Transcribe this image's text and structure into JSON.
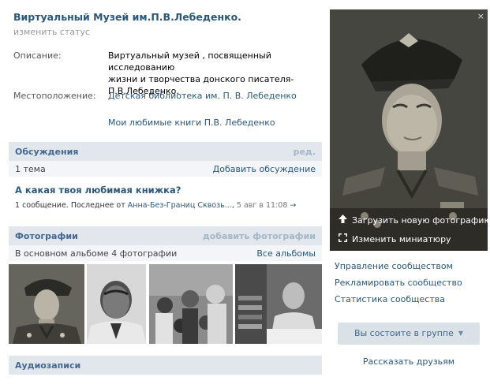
{
  "group": {
    "title": "Виртуальный Музей им.П.В.Лебеденко.",
    "status_link": "изменить статус"
  },
  "info": {
    "description_label": "Описание:",
    "description_lines": [
      "Виртуальный музей , посвященный исследованию",
      "жизни и творчества донского писателя-",
      "П.В.Лебеденко."
    ],
    "location_label": "Местоположение:",
    "location_value": "Детская библиотека им. П. В. Лебеденко",
    "favorite_link": "Мои любимые книги П.В. Лебеденко"
  },
  "discussions": {
    "header": "Обсуждения",
    "edit_label": "ред.",
    "count_text": "1 тема",
    "add_label": "Добавить обсуждение",
    "topic_title": "А какая твоя любимая книжка?",
    "topic_meta_prefix": "1 сообщение. Последнее от",
    "topic_author": "Анна-Без-Границ Сквозь...",
    "topic_time": "5 авг в 11:08",
    "topic_arrow": "→"
  },
  "photos": {
    "header": "Фотографии",
    "add_label": "добавить фотографии",
    "album_text": "В основном альбоме 4 фотографии",
    "all_albums_label": "Все альбомы"
  },
  "audio": {
    "header": "Аудиозаписи"
  },
  "sidebar": {
    "close_glyph": "×",
    "upload_label": "Загрузить новую фотографию",
    "thumb_label": "Изменить миниатюру",
    "links": [
      "Управление сообществом",
      "Рекламировать сообщество",
      "Статистика сообщества"
    ],
    "member_label": "Вы состоите в группе",
    "member_caret": "▼",
    "tell_friends_label": "Рассказать друзьям"
  },
  "icons": {
    "upload": "upload-arrow-icon",
    "thumbnail": "crop-corners-icon",
    "close": "close-icon",
    "caret": "caret-down-icon"
  },
  "colors": {
    "link": "#2b587a",
    "header_bg": "#e1e7ed",
    "subheader_bg": "#f3f5f8",
    "page_bg": "#edeef0",
    "button_bg": "#dae2e8"
  }
}
